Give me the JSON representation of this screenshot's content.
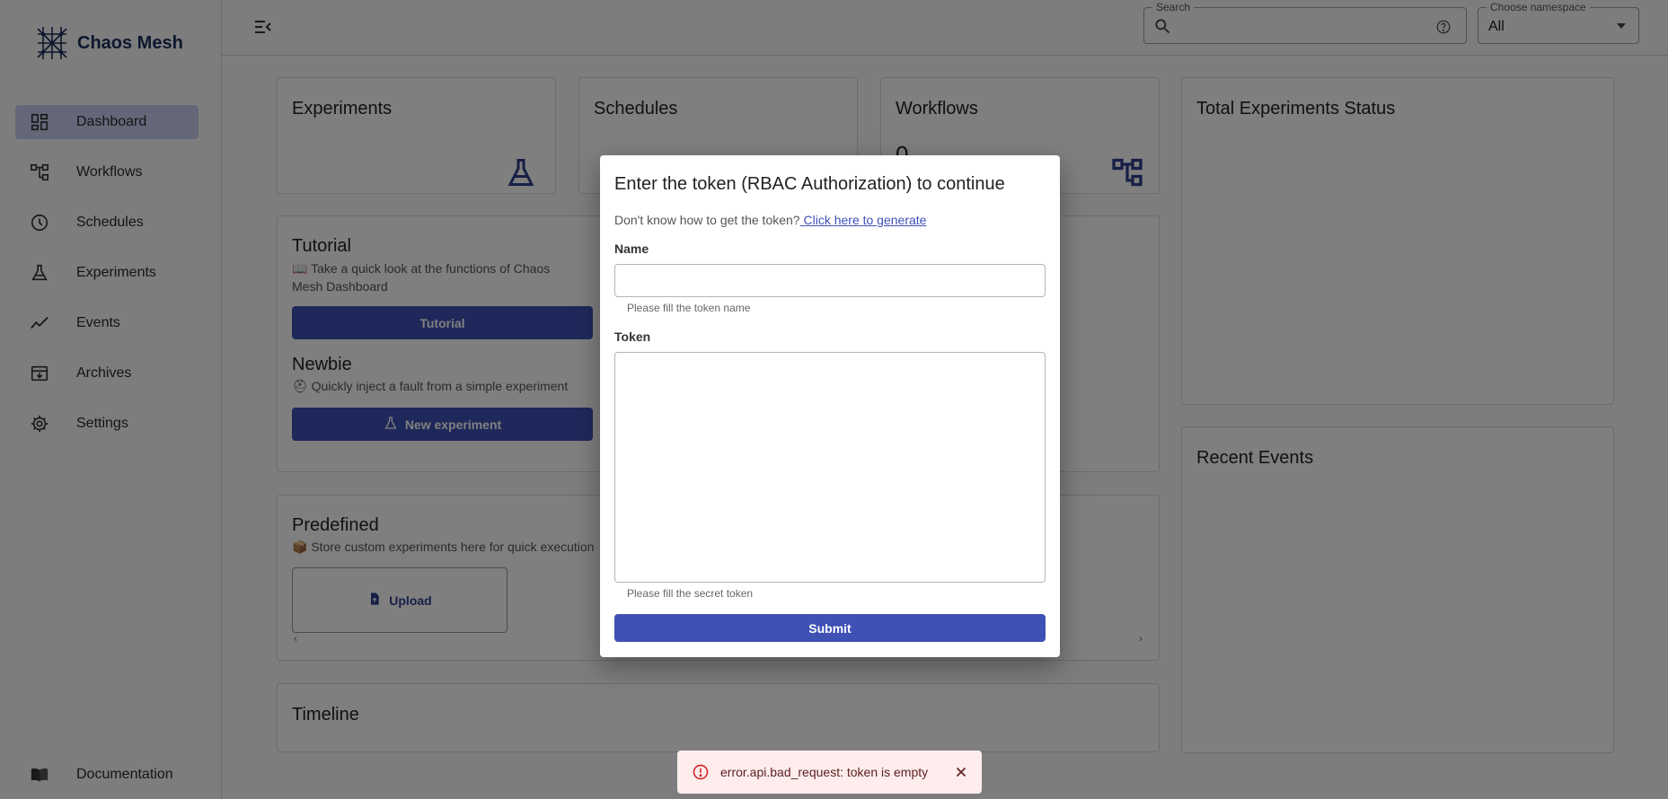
{
  "app": {
    "name": "Chaos Mesh"
  },
  "sidebar": {
    "items": [
      {
        "label": "Dashboard",
        "icon": "dashboard-icon",
        "active": true
      },
      {
        "label": "Workflows",
        "icon": "workflow-icon"
      },
      {
        "label": "Schedules",
        "icon": "clock-icon"
      },
      {
        "label": "Experiments",
        "icon": "flask-icon"
      },
      {
        "label": "Events",
        "icon": "timeline-icon"
      },
      {
        "label": "Archives",
        "icon": "archive-icon"
      },
      {
        "label": "Settings",
        "icon": "gear-icon"
      }
    ],
    "documentation": "Documentation"
  },
  "header": {
    "search_label": "Search",
    "search_value": "",
    "namespace_label": "Choose namespace",
    "namespace_value": "All"
  },
  "cards": {
    "experiments": "Experiments",
    "schedules": "Schedules",
    "workflows": "Workflows",
    "workflows_count": "0",
    "total_status": "Total Experiments Status",
    "recent_events": "Recent Events",
    "tutorial_title": "Tutorial",
    "tutorial_desc": "📖 Take a quick look at the functions of Chaos Mesh Dashboard",
    "tutorial_button": "Tutorial",
    "newbie_title": "Newbie",
    "newbie_desc": "⛑ Quickly inject a fault from a simple experiment",
    "new_experiment_button": "New experiment",
    "predefined_title": "Predefined",
    "predefined_desc": "📦 Store custom experiments here for quick execution",
    "upload_button": "Upload",
    "timeline_title": "Timeline"
  },
  "modal": {
    "title": "Enter the token (RBAC Authorization) to continue",
    "hint": "Don't know how to get the token?",
    "hint_link": " Click here to generate",
    "name_label": "Name",
    "name_value": "",
    "name_helper": "Please fill the token name",
    "token_label": "Token",
    "token_value": "",
    "token_helper": "Please fill the secret token",
    "submit_label": "Submit"
  },
  "snackbar": {
    "message": "error.api.bad_request: token is empty",
    "severity": "error"
  },
  "colors": {
    "primary": "#3f51b5",
    "active_nav": "#c8cef0",
    "error_bg": "#fdeded",
    "error_icon": "#d32f2f"
  }
}
